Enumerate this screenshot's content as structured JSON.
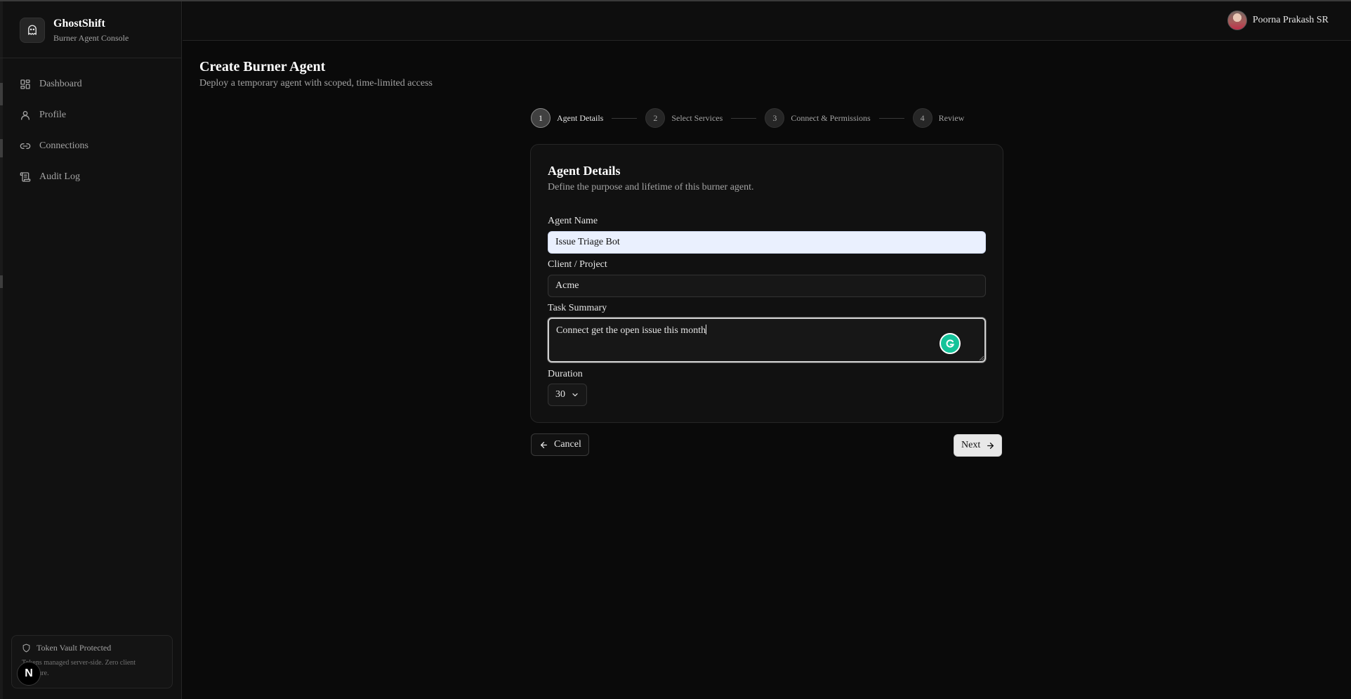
{
  "app": {
    "name": "GhostShift",
    "subtitle": "Burner Agent Console"
  },
  "sidebar": {
    "items": [
      {
        "label": "Dashboard",
        "icon": "grid-icon"
      },
      {
        "label": "Profile",
        "icon": "user-icon"
      },
      {
        "label": "Connections",
        "icon": "link-icon"
      },
      {
        "label": "Audit Log",
        "icon": "scroll-icon"
      }
    ],
    "vault": {
      "title": "Token Vault Protected",
      "description": "Tokens managed server-side. Zero client exposure.",
      "icon": "shield-icon"
    },
    "badge_letter": "N"
  },
  "header": {
    "user_name": "Poorna Prakash SR"
  },
  "page": {
    "title": "Create Burner Agent",
    "subtitle": "Deploy a temporary agent with scoped, time-limited access"
  },
  "stepper": {
    "steps": [
      {
        "number": "1",
        "label": "Agent Details",
        "active": true
      },
      {
        "number": "2",
        "label": "Select Services",
        "active": false
      },
      {
        "number": "3",
        "label": "Connect & Permissions",
        "active": false
      },
      {
        "number": "4",
        "label": "Review",
        "active": false
      }
    ]
  },
  "form": {
    "title": "Agent Details",
    "subtitle": "Define the purpose and lifetime of this burner agent.",
    "agent_name": {
      "label": "Agent Name",
      "value": "Issue Triage Bot"
    },
    "client": {
      "label": "Client / Project",
      "value": "Acme"
    },
    "task": {
      "label": "Task Summary",
      "value": "Connect get the open issue this month"
    },
    "duration": {
      "label": "Duration",
      "value": "30"
    }
  },
  "actions": {
    "cancel": "Cancel",
    "next": "Next"
  },
  "colors": {
    "background": "#0a0a0a",
    "sidebar": "#111111",
    "grammarly": "#15c39a"
  }
}
